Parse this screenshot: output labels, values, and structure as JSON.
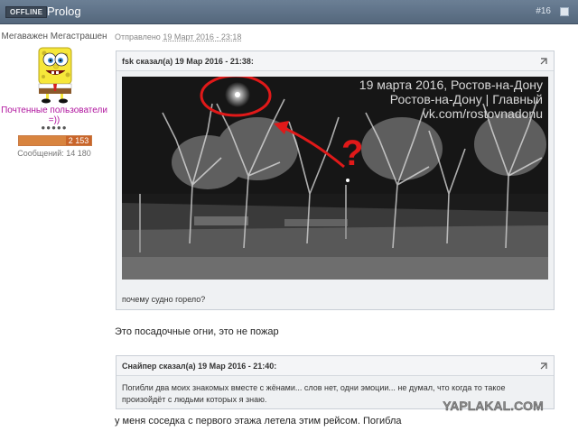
{
  "header": {
    "status_badge": "OFFLINE",
    "author": "Prolog",
    "post_number": "#16"
  },
  "user_panel": {
    "title": "Мегаважен Мегастрашен",
    "rank": "Почтенные пользователи =))",
    "rank_dots": "●●●●●",
    "reputation": 2153,
    "reputation_label": "2 153",
    "reputation_fill": 0.72,
    "messages": "Сообщений: 14 180"
  },
  "post": {
    "meta_prefix": "Отправлено",
    "meta_date": "19 Март 2016 - 23:18",
    "quote1": {
      "author": "fsk сказал(а) 19 Мар 2016 - 21:38:",
      "overlay_line1": "19 марта 2016, Ростов-на-Дону",
      "overlay_line2": "Ростов-на-Дону | Главный",
      "overlay_line3": "vk.com/rostovnadonu",
      "question_mark": "?",
      "caption": "почему судно горело?"
    },
    "reply1": "Это посадочные огни, это не пожар",
    "quote2": {
      "author": "Снайпер сказал(а) 19 Мар 2016 - 21:40:",
      "text": "Погибли два моих знакомых вместе с жёнами... слов нет, одни эмоции... не думал, что когда то такое произойдёт с людьми которых я знаю."
    },
    "reply2": "у меня соседка с первого этажа летела этим рейсом. Погибла"
  },
  "watermark": "YAPLAKAL.COM",
  "colors": {
    "header_bg": "#5d7086",
    "rank_color": "#b0149e",
    "annotation_red": "#e01919",
    "rep_bar": "#d8843f"
  }
}
